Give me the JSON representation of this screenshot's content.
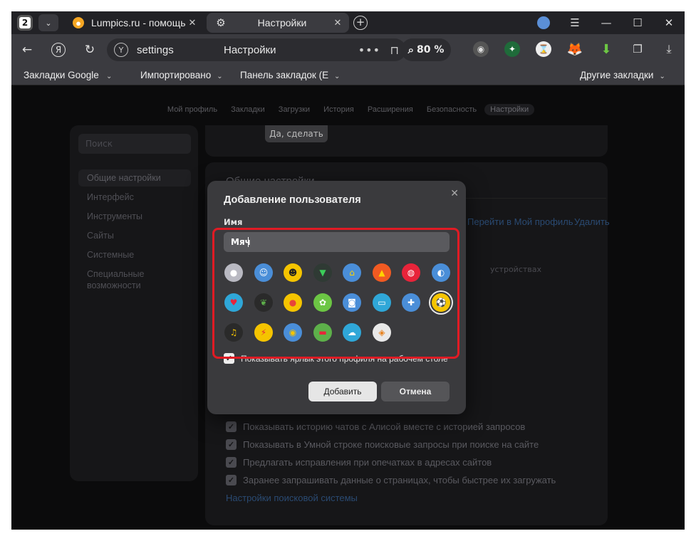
{
  "tabbar": {
    "tab_count": "2",
    "tabs": [
      {
        "title": "Lumpics.ru - помощь с компьютером",
        "favicon": "orange-circle-icon"
      },
      {
        "title": "Настройки",
        "favicon": "gear-icon"
      }
    ]
  },
  "navbar": {
    "url": "settings",
    "page_title": "Настройки",
    "zoom": "80 %"
  },
  "bookmarks": {
    "items": [
      "Закладки Google Chrome",
      "Импортировано",
      "Панель закладок (Edge)"
    ],
    "other": "Другие закладки"
  },
  "subnav": [
    "Мой профиль",
    "Закладки",
    "Загрузки",
    "История",
    "Расширения",
    "Безопасность",
    "Настройки"
  ],
  "sidebar": {
    "search_placeholder": "Поиск",
    "items": [
      "Общие настройки",
      "Интерфейс",
      "Инструменты",
      "Сайты",
      "Системные",
      "Специальные возможности"
    ]
  },
  "main": {
    "confirm_button": "Да, сделать",
    "section_title": "Общие настройки",
    "profile_link": "Перейти в Мой профиль",
    "delete_link": "Удалить",
    "devices_text": "устройствах",
    "checkboxes": [
      "Показывать историю чатов с Алисой вместе с историей запросов",
      "Показывать в Умной строке поисковые запросы при поиске на сайте",
      "Предлагать исправления при опечатках в адресах сайтов",
      "Заранее запрашивать данные о страницах, чтобы быстрее их загружать"
    ],
    "search_settings_link": "Настройки поисковой системы"
  },
  "modal": {
    "title": "Добавление пользователя",
    "name_label": "Имя",
    "name_value": "Мяч",
    "avatars": [
      "default-person-icon",
      "boy-icon",
      "girl-icon",
      "alien-icon",
      "robot-icon",
      "fox-icon",
      "cat-icon",
      "penguin-icon",
      "strawberry-icon",
      "leaf-icon",
      "tomato-icon",
      "flower-icon",
      "camera-icon",
      "cassette-icon",
      "gamepad-icon",
      "soccer-ball-icon",
      "music-note-icon",
      "lightning-icon",
      "balloon-icon",
      "car-icon",
      "cloud-icon",
      "pastry-icon"
    ],
    "selected_avatar": "soccer-ball-icon",
    "shortcut_label": "Показывать ярлык этого профиля на рабочем столе",
    "add_button": "Добавить",
    "cancel_button": "Отмена"
  },
  "colors": {
    "highlight": "#e01b24",
    "link": "#2a4a72"
  }
}
